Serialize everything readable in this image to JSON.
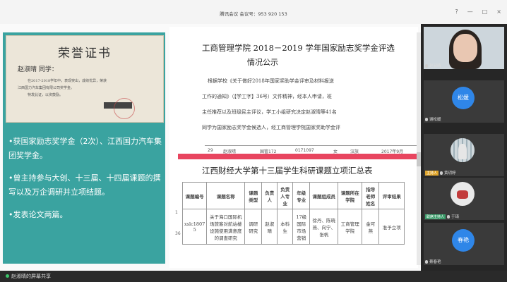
{
  "topbar": {
    "meeting_id": "腾讯会议 会议号：953 920 153",
    "controls": [
      "?",
      "—",
      "□",
      "×"
    ]
  },
  "slide": {
    "certificate": {
      "title": "荣誉证书",
      "recipient": "赵淑晴  同学：",
      "lines": [
        "在2017-2018学年中，表现突出，成绩优异，荣获",
        "江西国力汽车集团有限公司奖学金。",
        "特发此证，以资鼓励。"
      ]
    },
    "bullets": [
      "•获国家励志奖学金（2次）、江西国力汽车集团奖学金。",
      "•曾主持参与大创、十三届、十四届课题的撰写以及万企调研并立项结题。",
      "•发表论文两篇。"
    ]
  },
  "document": {
    "title_line1": "工商管理学院 2018－2019 学年国家励志奖学金评选",
    "title_line2": "情况公示",
    "paragraph": [
      "根据学校《关于做好2018年国家奖助学金评审及材料报送",
      "工作的通知》（【学工字】36号）文件精神，经本人申请，班",
      "主任推荐以及班级民主评议，学工小组研究决定赵淑晴等41名",
      "同学为国家励志奖学金候选人，经工商管理学院国家奖助学金评"
    ],
    "data_row": [
      "29",
      "赵淑晴",
      "国管172",
      "0171097",
      "女",
      "汉族",
      "2017年9月"
    ],
    "table_title": "江西财经大学第十三届学生科研课题立项汇总表",
    "table_headers": [
      "课题编号",
      "课题名称",
      "课题类型",
      "负责人",
      "负责人专业",
      "年级专业",
      "课题组成员",
      "课题所在学院",
      "指导老师姓名",
      "评审结果"
    ],
    "table_row": [
      "xslc1807 5",
      "关于海口国际机场旅客对航站楼设施使用满意度的调查研究",
      "调研研究",
      "赵淑晴",
      "本科生",
      "17级国际市场营销",
      "徐丹、陈晓燕、向宁、张帆",
      "工商管理学院",
      "金可燕",
      "准予立项"
    ],
    "row_numbers": [
      "1",
      "36"
    ]
  },
  "sharebar": {
    "text": "赵淑晴的屏幕共享"
  },
  "participants": [
    {
      "name": "赵淑晴",
      "type": "video"
    },
    {
      "name": "谢松媛",
      "avatar_text": "松媛",
      "color": "#2f86e8"
    },
    {
      "name": "黄玥婷",
      "tag": "主持人",
      "type": "photo"
    },
    {
      "name": "于琦",
      "tag": "联席主持人",
      "type": "photo2"
    },
    {
      "name": "蔡春艳",
      "avatar_text": "春艳",
      "color": "#2f86e8"
    }
  ]
}
